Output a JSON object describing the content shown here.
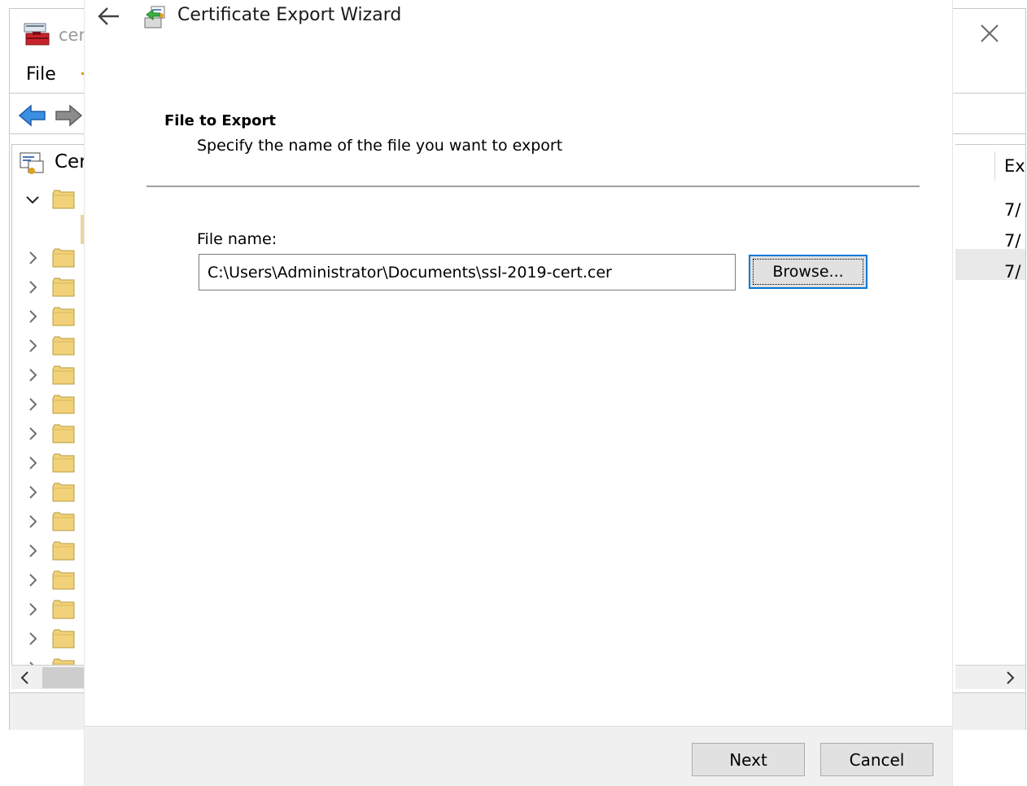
{
  "background_window": {
    "title": "cer",
    "menu": {
      "file": "File"
    },
    "tree": {
      "root_label": "Cer",
      "folder_count": 16
    },
    "right_pane": {
      "column_header": "Ex",
      "values": [
        "7/",
        "7/",
        "7/"
      ]
    }
  },
  "wizard": {
    "title": "Certificate Export Wizard",
    "heading": "File to Export",
    "subheading": "Specify the name of the file you want to export",
    "file_label": "File name:",
    "file_value": "C:\\Users\\Administrator\\Documents\\ssl-2019-cert.cer",
    "browse_label": "Browse...",
    "next_label": "Next",
    "cancel_label": "Cancel"
  },
  "colors": {
    "accent": "#0078d7",
    "folder": "#f1d27a",
    "button_face": "#e1e1e1",
    "footer": "#f0f0f0"
  }
}
